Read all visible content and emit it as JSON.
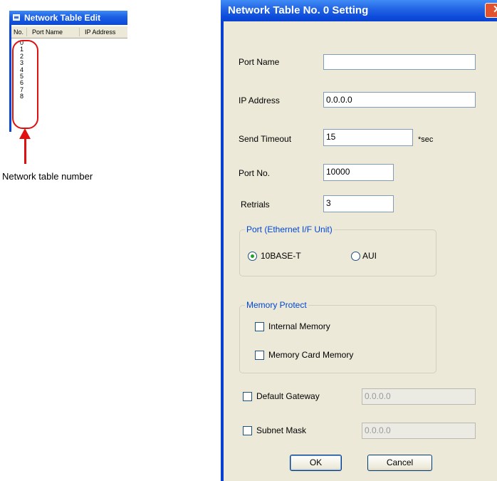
{
  "mini_window": {
    "title": "Network Table Edit",
    "columns": [
      "No.",
      "Port Name",
      "IP Address"
    ],
    "rows": [
      "0",
      "1",
      "2",
      "3",
      "4",
      "5",
      "6",
      "7",
      "8"
    ]
  },
  "annotation": {
    "caption": "Network table number",
    "highlight_color": "#e01010"
  },
  "dialog": {
    "title": "Network Table No. 0 Setting",
    "close_glyph": "✕",
    "port_name": {
      "label": "Port Name",
      "value": ""
    },
    "ip_address": {
      "label": "IP Address",
      "value": "0.0.0.0"
    },
    "send_timeout": {
      "label": "Send Timeout",
      "value": "15",
      "unit": "*sec"
    },
    "port_no": {
      "label": "Port No.",
      "value": "10000"
    },
    "retrials": {
      "label": "Retrials",
      "value": "3"
    },
    "port_group": {
      "title": "Port (Ethernet I/F Unit)",
      "options": [
        "10BASE-T",
        "AUI"
      ],
      "selected": "10BASE-T"
    },
    "memory_group": {
      "title": "Memory Protect",
      "internal_memory": {
        "label": "Internal Memory",
        "checked": false
      },
      "card_memory": {
        "label": "Memory Card Memory",
        "checked": false
      }
    },
    "default_gateway": {
      "label": "Default Gateway",
      "checked": false,
      "value": "0.0.0.0"
    },
    "subnet_mask": {
      "label": "Subnet Mask",
      "checked": false,
      "value": "0.0.0.0"
    },
    "ok_label": "OK",
    "cancel_label": "Cancel"
  },
  "colors": {
    "title_bar": "#0b48d9",
    "dialog_face": "#ece9d8",
    "group_title": "#0046d5",
    "radio_dot": "#21a121",
    "close_button": "#e0532e"
  }
}
